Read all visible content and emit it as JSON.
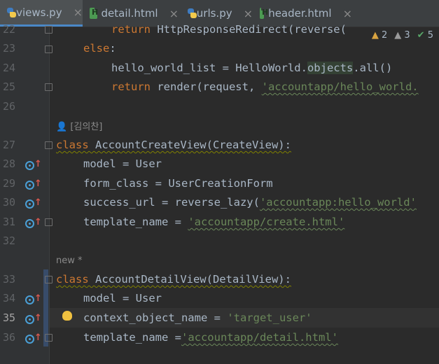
{
  "tabs": [
    {
      "label": "views.py",
      "icon": "python-file-icon",
      "active": true
    },
    {
      "label": "detail.html",
      "icon": "html-file-icon",
      "active": false
    },
    {
      "label": "urls.py",
      "icon": "python-file-icon",
      "active": false
    },
    {
      "label": "header.html",
      "icon": "html-file-icon",
      "active": false
    }
  ],
  "close_glyph": "×",
  "inspections": {
    "warnings": "2",
    "weak_warnings": "3",
    "ok": "5"
  },
  "lines": {
    "l22": {
      "num": "22",
      "text_kw": "return ",
      "text": "HttpResponseRedirect(reverse("
    },
    "l23": {
      "num": "23",
      "text_kw": "else",
      "text": ":"
    },
    "l24": {
      "num": "24",
      "a": "hello_world_list = HelloWorld.",
      "b": "objects",
      "c": ".all()"
    },
    "l25": {
      "num": "25",
      "kw": "return ",
      "a": "render(request, ",
      "s": "'accountapp/hello_world."
    },
    "l26": {
      "num": "26"
    },
    "author": "[김의찬]",
    "l27": {
      "num": "27",
      "kw": "class ",
      "a": "AccountCreateView(CreateView):"
    },
    "l28": {
      "num": "28",
      "a": "model = User"
    },
    "l29": {
      "num": "29",
      "a": "form_class = UserCreationForm"
    },
    "l30": {
      "num": "30",
      "a": "success_url = reverse_lazy(",
      "s": "'accountapp:hello_world'"
    },
    "l31": {
      "num": "31",
      "a": "template_name = ",
      "s": "'accountapp/create.html'"
    },
    "l32": {
      "num": "32"
    },
    "new_note": "new *",
    "l33": {
      "num": "33",
      "kw": "class ",
      "a": "AccountDetailView(DetailView):"
    },
    "l34": {
      "num": "34",
      "a": "model = User"
    },
    "l35": {
      "num": "35",
      "a": "context_object_name = ",
      "s": "'target_user'"
    },
    "l36": {
      "num": "36",
      "a": "template_name =",
      "s": "'accountapp/detail.html'"
    }
  }
}
